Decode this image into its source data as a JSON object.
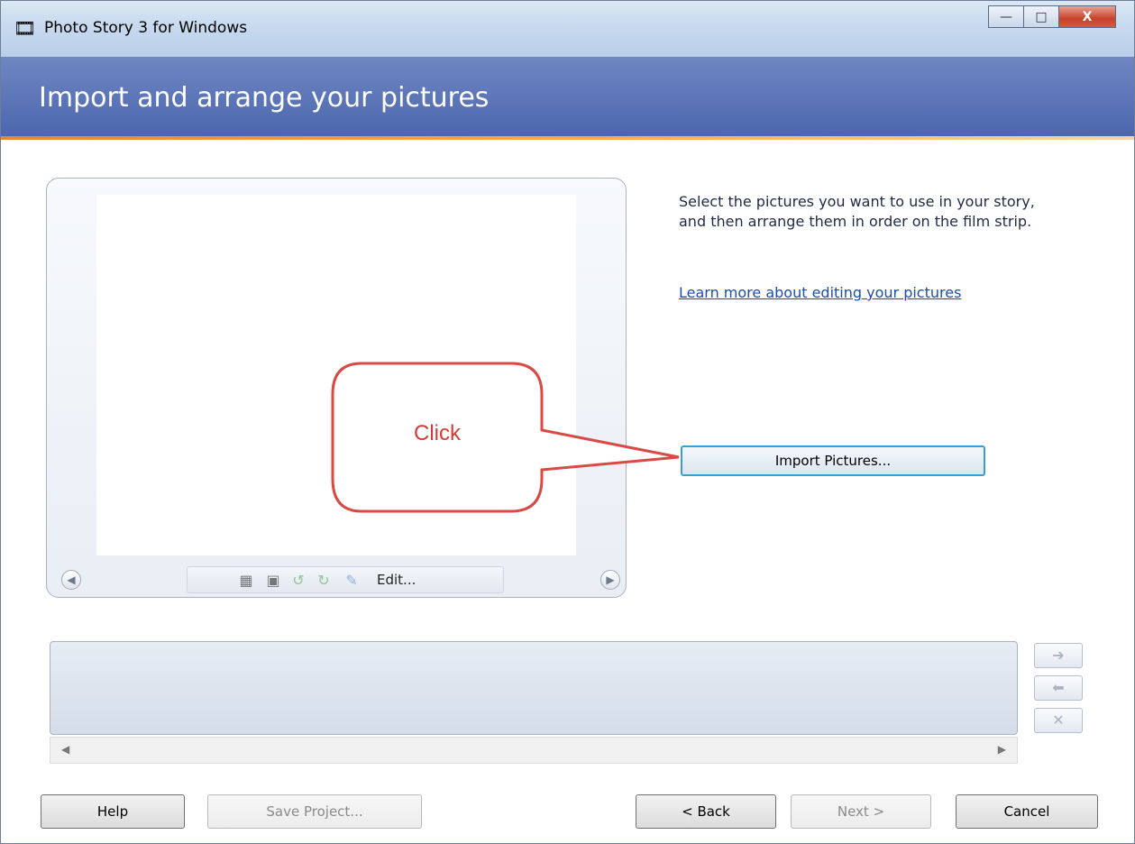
{
  "window": {
    "title": "Photo Story 3 for Windows",
    "controls": {
      "minimize": "—",
      "maximize": "□",
      "close": "X"
    }
  },
  "header": {
    "title": "Import and arrange your pictures"
  },
  "preview": {
    "toolbar": {
      "icons": [
        "auto-correct-icon",
        "red-eye-icon",
        "rotate-left-icon",
        "rotate-right-icon",
        "edit-icon"
      ],
      "edit_label": "Edit..."
    }
  },
  "instructions": {
    "text": "Select the pictures you want to use in your story, and then arrange them in order on the film strip.",
    "link": "Learn more about editing your pictures"
  },
  "import_button": "Import Pictures...",
  "callout": {
    "text": "Click",
    "color": "#d53b35"
  },
  "buttons": {
    "help": "Help",
    "save_project": "Save Project...",
    "back": "< Back",
    "next": "Next >",
    "cancel": "Cancel"
  },
  "colors": {
    "header": "#5670b4",
    "accent_line": "#f4a850",
    "link": "#1c4ea8"
  }
}
